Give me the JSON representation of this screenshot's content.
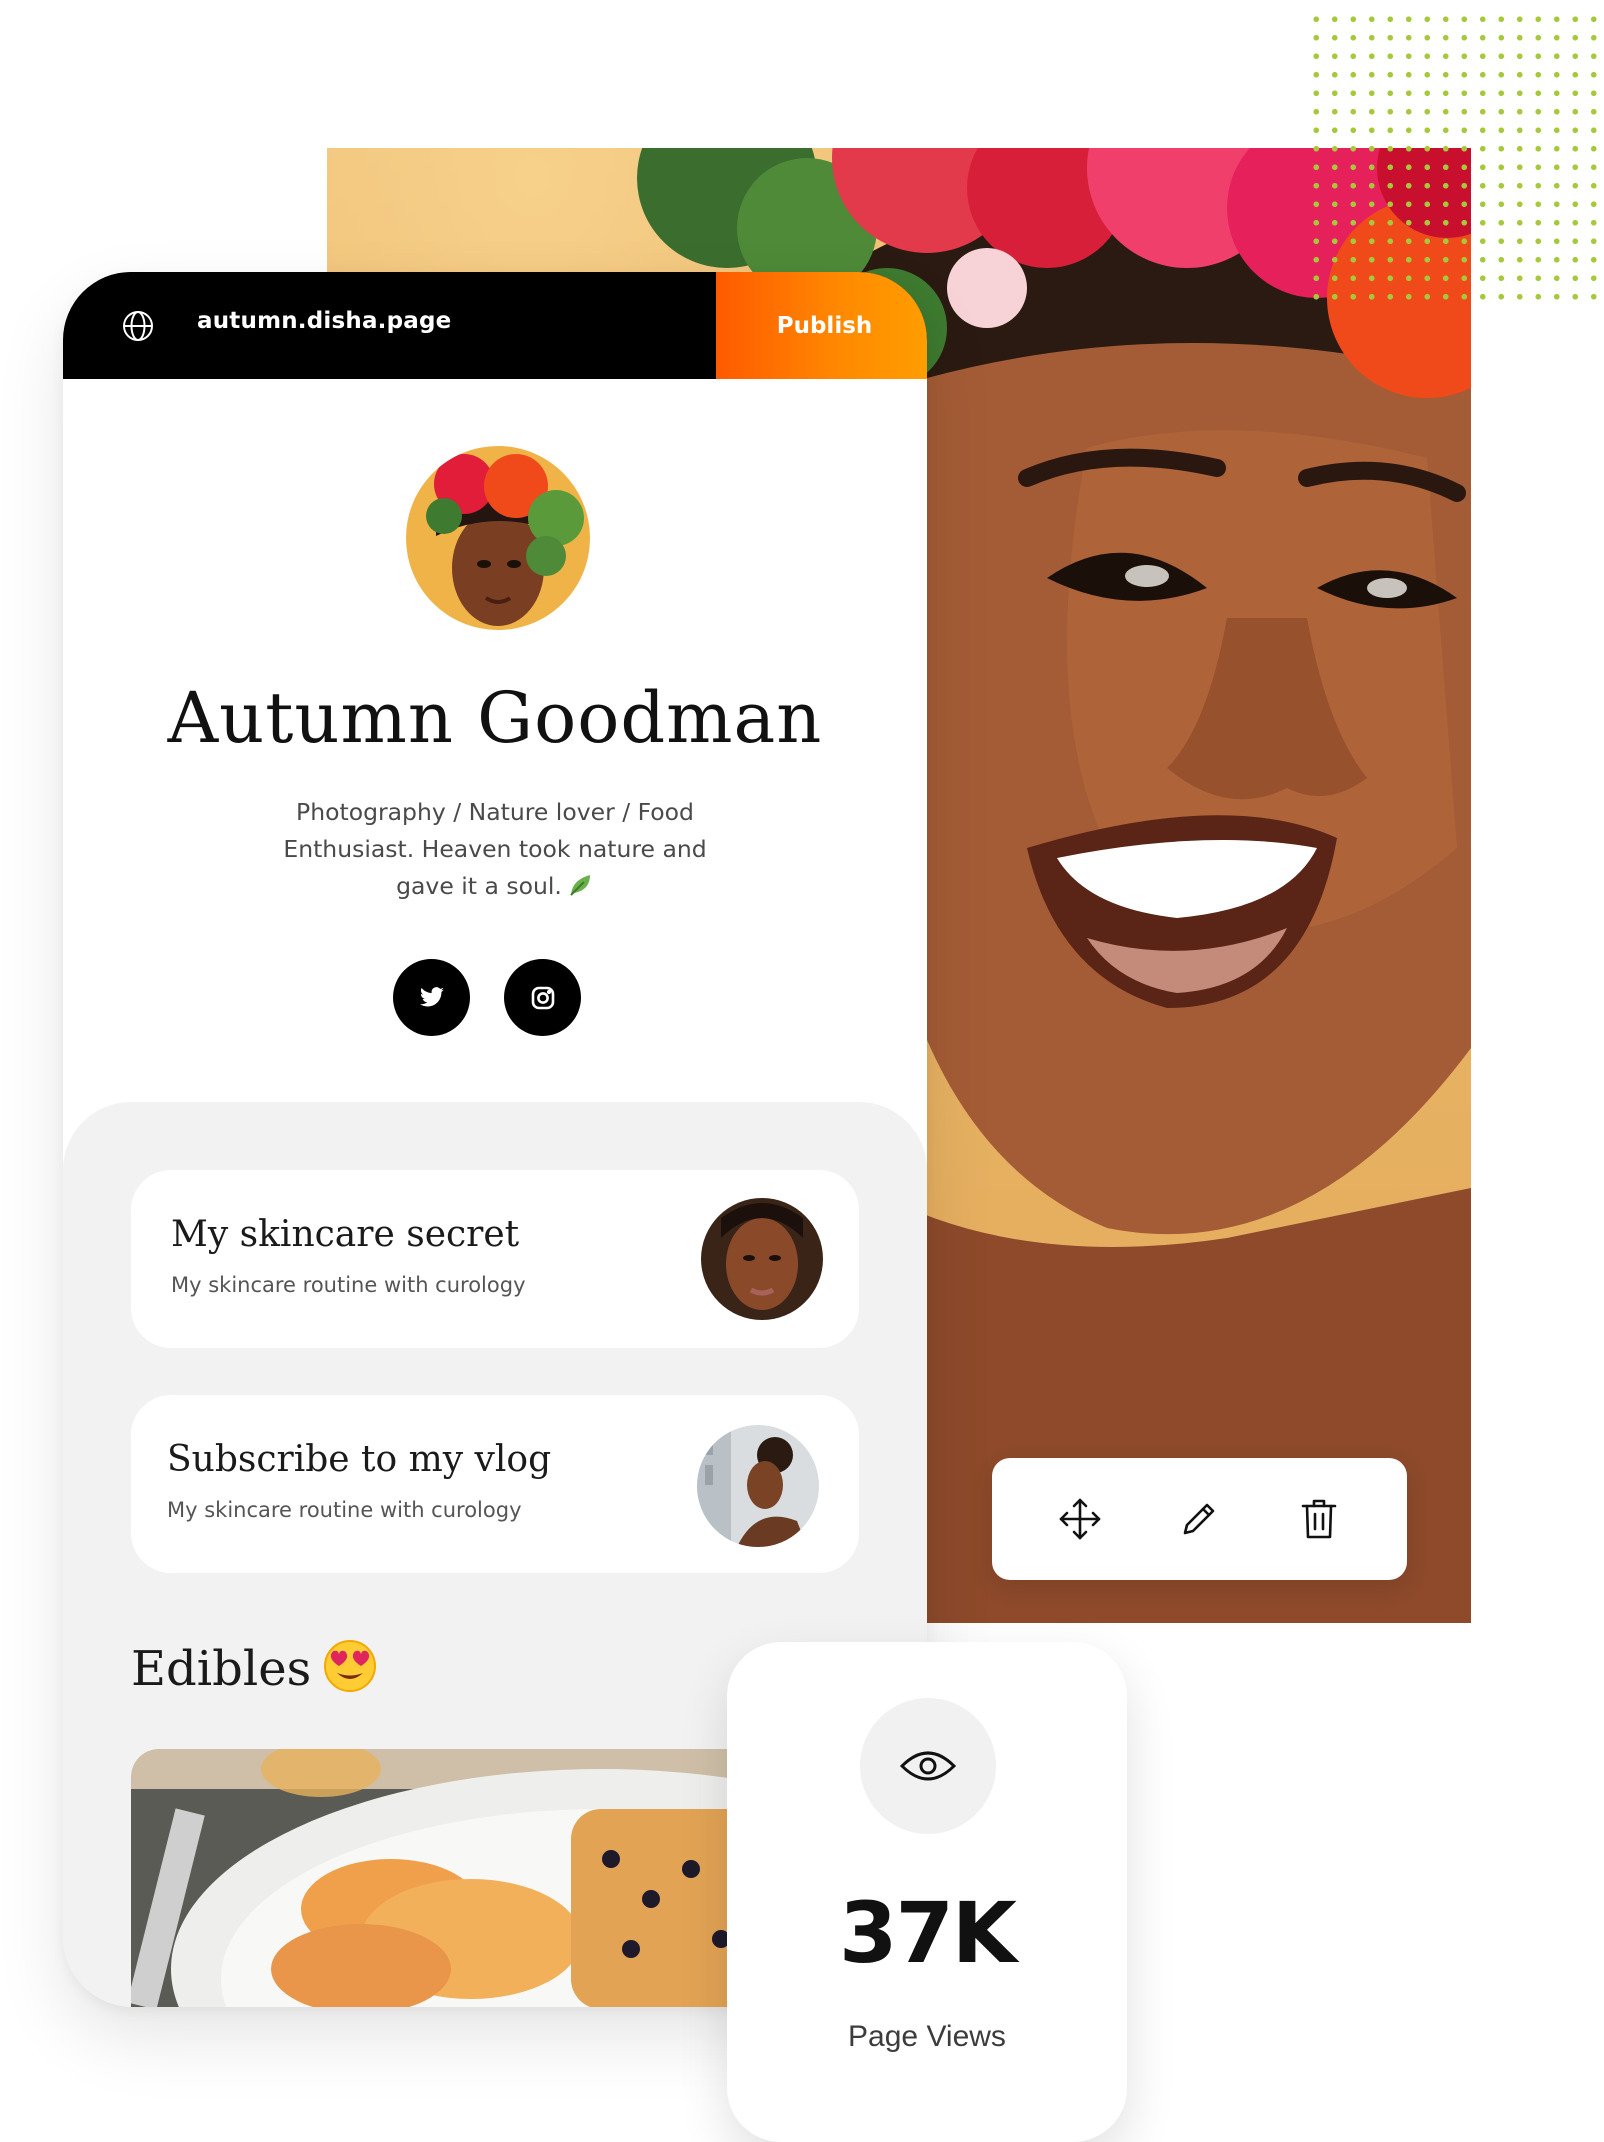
{
  "editor": {
    "url": "autumn.disha.page",
    "publish_label": "Publish"
  },
  "profile": {
    "name": "Autumn Goodman",
    "bio": "Photography / Nature lover / Food Enthusiast. Heaven took nature and gave it a soul.",
    "socials": [
      "twitter-icon",
      "instagram-icon"
    ]
  },
  "links": [
    {
      "title": "My skincare secret",
      "subtitle": "My skincare routine with curology"
    },
    {
      "title": "Subscribe to my vlog",
      "subtitle": "My skincare routine with curology"
    }
  ],
  "section": {
    "title": "Edibles"
  },
  "toolbar": {
    "icons": [
      "move-icon",
      "edit-icon",
      "delete-icon"
    ]
  },
  "stats": {
    "value": "37K",
    "label": "Page Views"
  },
  "colors": {
    "accent_start": "#ff5a00",
    "accent_end": "#ff9d00",
    "dot_grid": "#a6c93b",
    "hero_background": "#eab667"
  }
}
